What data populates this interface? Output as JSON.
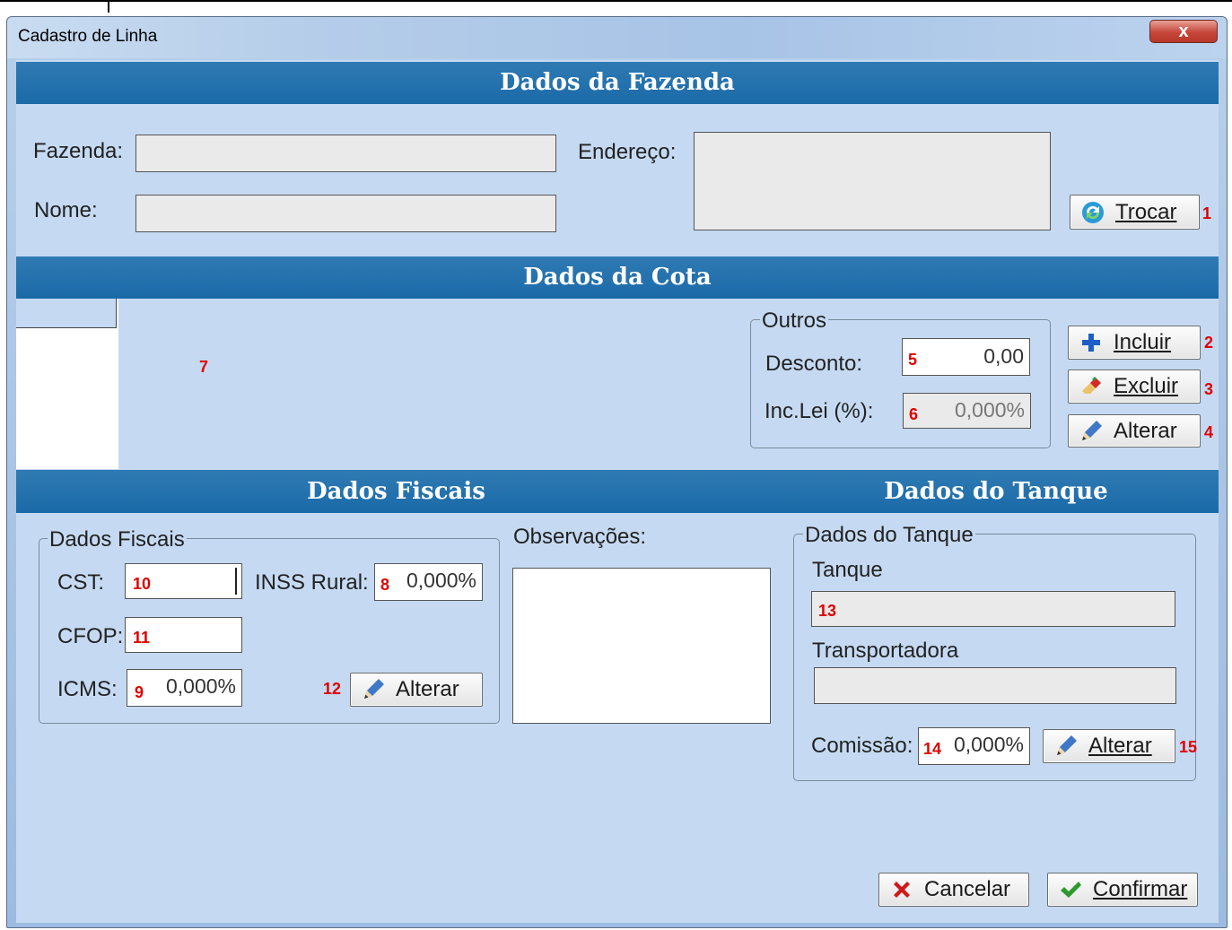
{
  "window": {
    "title": "Cadastro de Linha",
    "close_label": "x"
  },
  "sections": {
    "fazenda": "Dados da Fazenda",
    "cota": "Dados da Cota",
    "fiscais": "Dados Fiscais",
    "tanque": "Dados do Tanque"
  },
  "fazenda": {
    "fazenda_label": "Fazenda:",
    "fazenda_value": "",
    "nome_label": "Nome:",
    "nome_value": "",
    "endereco_label": "Endereço:",
    "endereco_value": "",
    "trocar_button": "Trocar",
    "marker_trocar": "1"
  },
  "cota": {
    "grid_marker": "7",
    "outros_group": "Outros",
    "desconto_label": "Desconto:",
    "desconto_value": "0,00",
    "desconto_marker": "5",
    "inclei_label": "Inc.Lei (%):",
    "inclei_value": "0,000%",
    "inclei_marker": "6",
    "incluir_button": "Incluir",
    "excluir_button": "Excluir",
    "alterar_button": "Alterar",
    "marker_incluir": "2",
    "marker_excluir": "3",
    "marker_alterar": "4"
  },
  "fiscais": {
    "group_label": "Dados Fiscais",
    "cst_label": "CST:",
    "cst_marker": "10",
    "cst_value": "",
    "inss_label": "INSS Rural:",
    "inss_marker": "8",
    "inss_value": "0,000%",
    "cfop_label": "CFOP:",
    "cfop_marker": "11",
    "cfop_value": "",
    "icms_label": "ICMS:",
    "icms_marker": "9",
    "icms_value": "0,000%",
    "alterar_marker": "12",
    "alterar_button": "Alterar"
  },
  "observacoes": {
    "label": "Observações:",
    "value": ""
  },
  "tanque": {
    "group_label": "Dados do Tanque",
    "tanque_label": "Tanque",
    "tanque_marker": "13",
    "tanque_value": "",
    "transportadora_label": "Transportadora",
    "transportadora_value": "",
    "comissao_label": "Comissão:",
    "comissao_marker": "14",
    "comissao_value": "0,000%",
    "alterar_button": "Alterar",
    "alterar_marker": "15"
  },
  "footer": {
    "cancelar_button": "Cancelar",
    "confirmar_button": "Confirmar"
  },
  "colors": {
    "section_bar": "#1f6fab",
    "client_bg": "#c5daf2",
    "marker": "#e00000"
  }
}
